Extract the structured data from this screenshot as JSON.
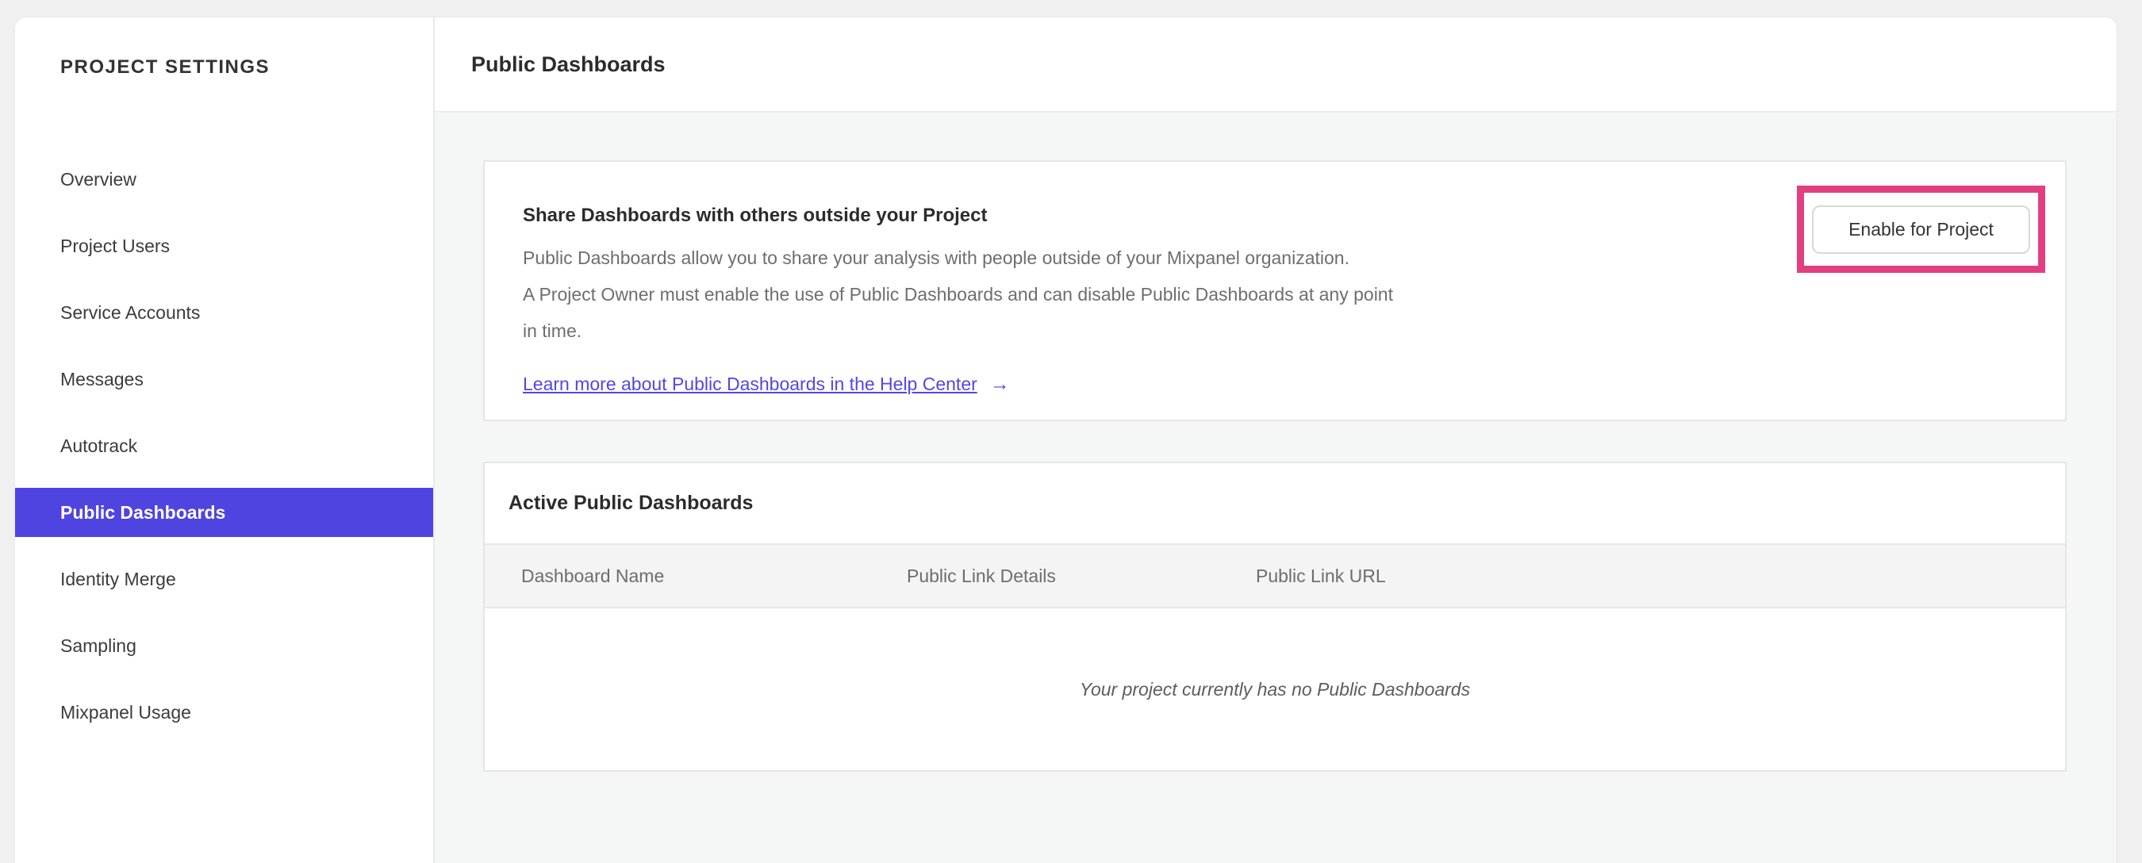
{
  "sidebar": {
    "title": "PROJECT SETTINGS",
    "items": [
      {
        "label": "Overview",
        "selected": false
      },
      {
        "label": "Project Users",
        "selected": false
      },
      {
        "label": "Service Accounts",
        "selected": false
      },
      {
        "label": "Messages",
        "selected": false
      },
      {
        "label": "Autotrack",
        "selected": false
      },
      {
        "label": "Public Dashboards",
        "selected": true
      },
      {
        "label": "Identity Merge",
        "selected": false
      },
      {
        "label": "Sampling",
        "selected": false
      },
      {
        "label": "Mixpanel Usage",
        "selected": false
      }
    ]
  },
  "header": {
    "title": "Public Dashboards"
  },
  "share_card": {
    "title": "Share Dashboards with others outside your Project",
    "body_lines": [
      "Public Dashboards allow you to share your analysis with people outside of your Mixpanel organization.",
      "A Project Owner must enable the use of Public Dashboards and can disable Public Dashboards at any point",
      "in time."
    ],
    "link_label": "Learn more about Public Dashboards in the Help Center",
    "link_arrow": "→",
    "enable_button_label": "Enable for Project"
  },
  "active_card": {
    "title": "Active Public Dashboards",
    "columns": [
      "Dashboard Name",
      "Public Link Details",
      "Public Link URL"
    ],
    "rows": [],
    "empty_message": "Your project currently has no Public Dashboards"
  },
  "colors": {
    "accent_purple": "#4f44e0",
    "annotation_pink": "#e23f80",
    "link_blue": "#5347e1"
  }
}
